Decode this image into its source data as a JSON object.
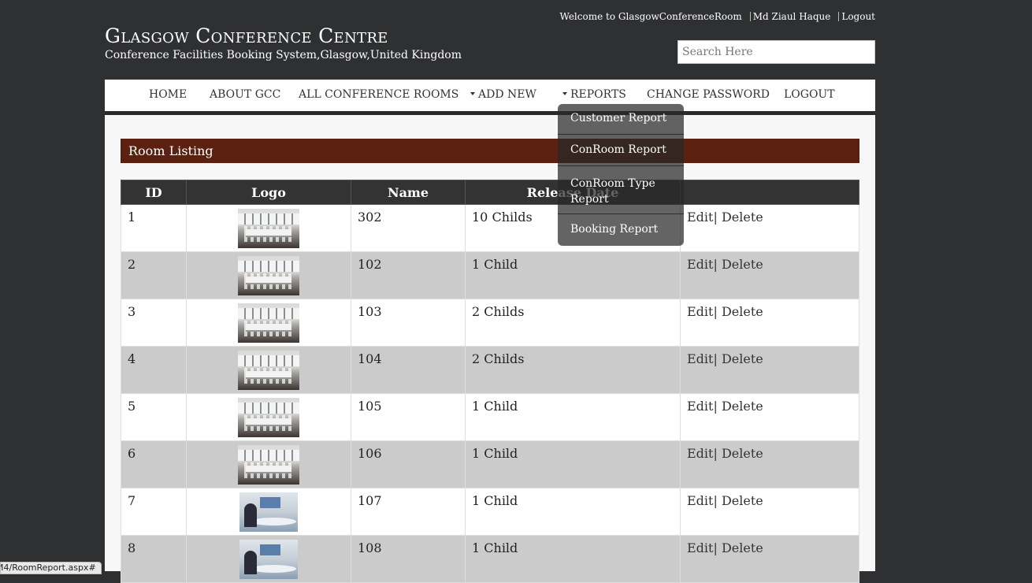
{
  "topbar": {
    "welcome": "Welcome to GlasgowConferenceRoom",
    "user": "Md Ziaul Haque",
    "logout": "Logout"
  },
  "brand": {
    "title": "Glasgow Conference Centre",
    "subtitle": "Conference Facilities Booking System,Glasgow,United Kingdom"
  },
  "search": {
    "placeholder": "Search Here",
    "value": ""
  },
  "nav": {
    "home": "HOME",
    "about": "ABOUT GCC",
    "all_rooms": "ALL CONFERENCE ROOMS",
    "add_new": "ADD NEW",
    "reports": "REPORTS",
    "change_password": "CHANGE PASSWORD",
    "logout": "LOGOUT"
  },
  "reports_menu": {
    "items": [
      "Customer Report",
      "ConRoom Report",
      "ConRoom Type Report",
      "Booking Report"
    ],
    "type_line1": "ConRoom Type",
    "type_line2": "Report"
  },
  "page": {
    "banner": "Room Listing"
  },
  "table": {
    "headers": [
      "ID",
      "Logo",
      "Name",
      "Release Date",
      ""
    ],
    "rows": [
      {
        "id": "1",
        "name": "302",
        "release": "10 Childs",
        "edit": "Edit",
        "delete": "| Delete",
        "logo": "conference-room-photo"
      },
      {
        "id": "2",
        "name": "102",
        "release": "1 Child",
        "edit": "Edit",
        "delete": "| Delete",
        "logo": "conference-room-photo"
      },
      {
        "id": "3",
        "name": "103",
        "release": "2 Childs",
        "edit": "Edit",
        "delete": "| Delete",
        "logo": "conference-room-photo"
      },
      {
        "id": "4",
        "name": "104",
        "release": "2 Childs",
        "edit": "Edit",
        "delete": "| Delete",
        "logo": "conference-room-photo"
      },
      {
        "id": "5",
        "name": "105",
        "release": "1 Child",
        "edit": "Edit",
        "delete": "| Delete",
        "logo": "conference-room-photo"
      },
      {
        "id": "6",
        "name": "106",
        "release": "1 Child",
        "edit": "Edit",
        "delete": "| Delete",
        "logo": "conference-room-photo"
      },
      {
        "id": "7",
        "name": "107",
        "release": "1 Child",
        "edit": "Edit",
        "delete": "| Delete",
        "logo": "meeting-room-photo"
      },
      {
        "id": "8",
        "name": "108",
        "release": "1 Child",
        "edit": "Edit",
        "delete": "| Delete",
        "logo": "meeting-room-photo"
      }
    ]
  },
  "statusbar": {
    "url": "M4/RoomReport.aspx#"
  },
  "colors": {
    "background": "#2f3031",
    "banner": "#5b2010",
    "header": "#333333",
    "row_alt": "#cbcbcb"
  }
}
